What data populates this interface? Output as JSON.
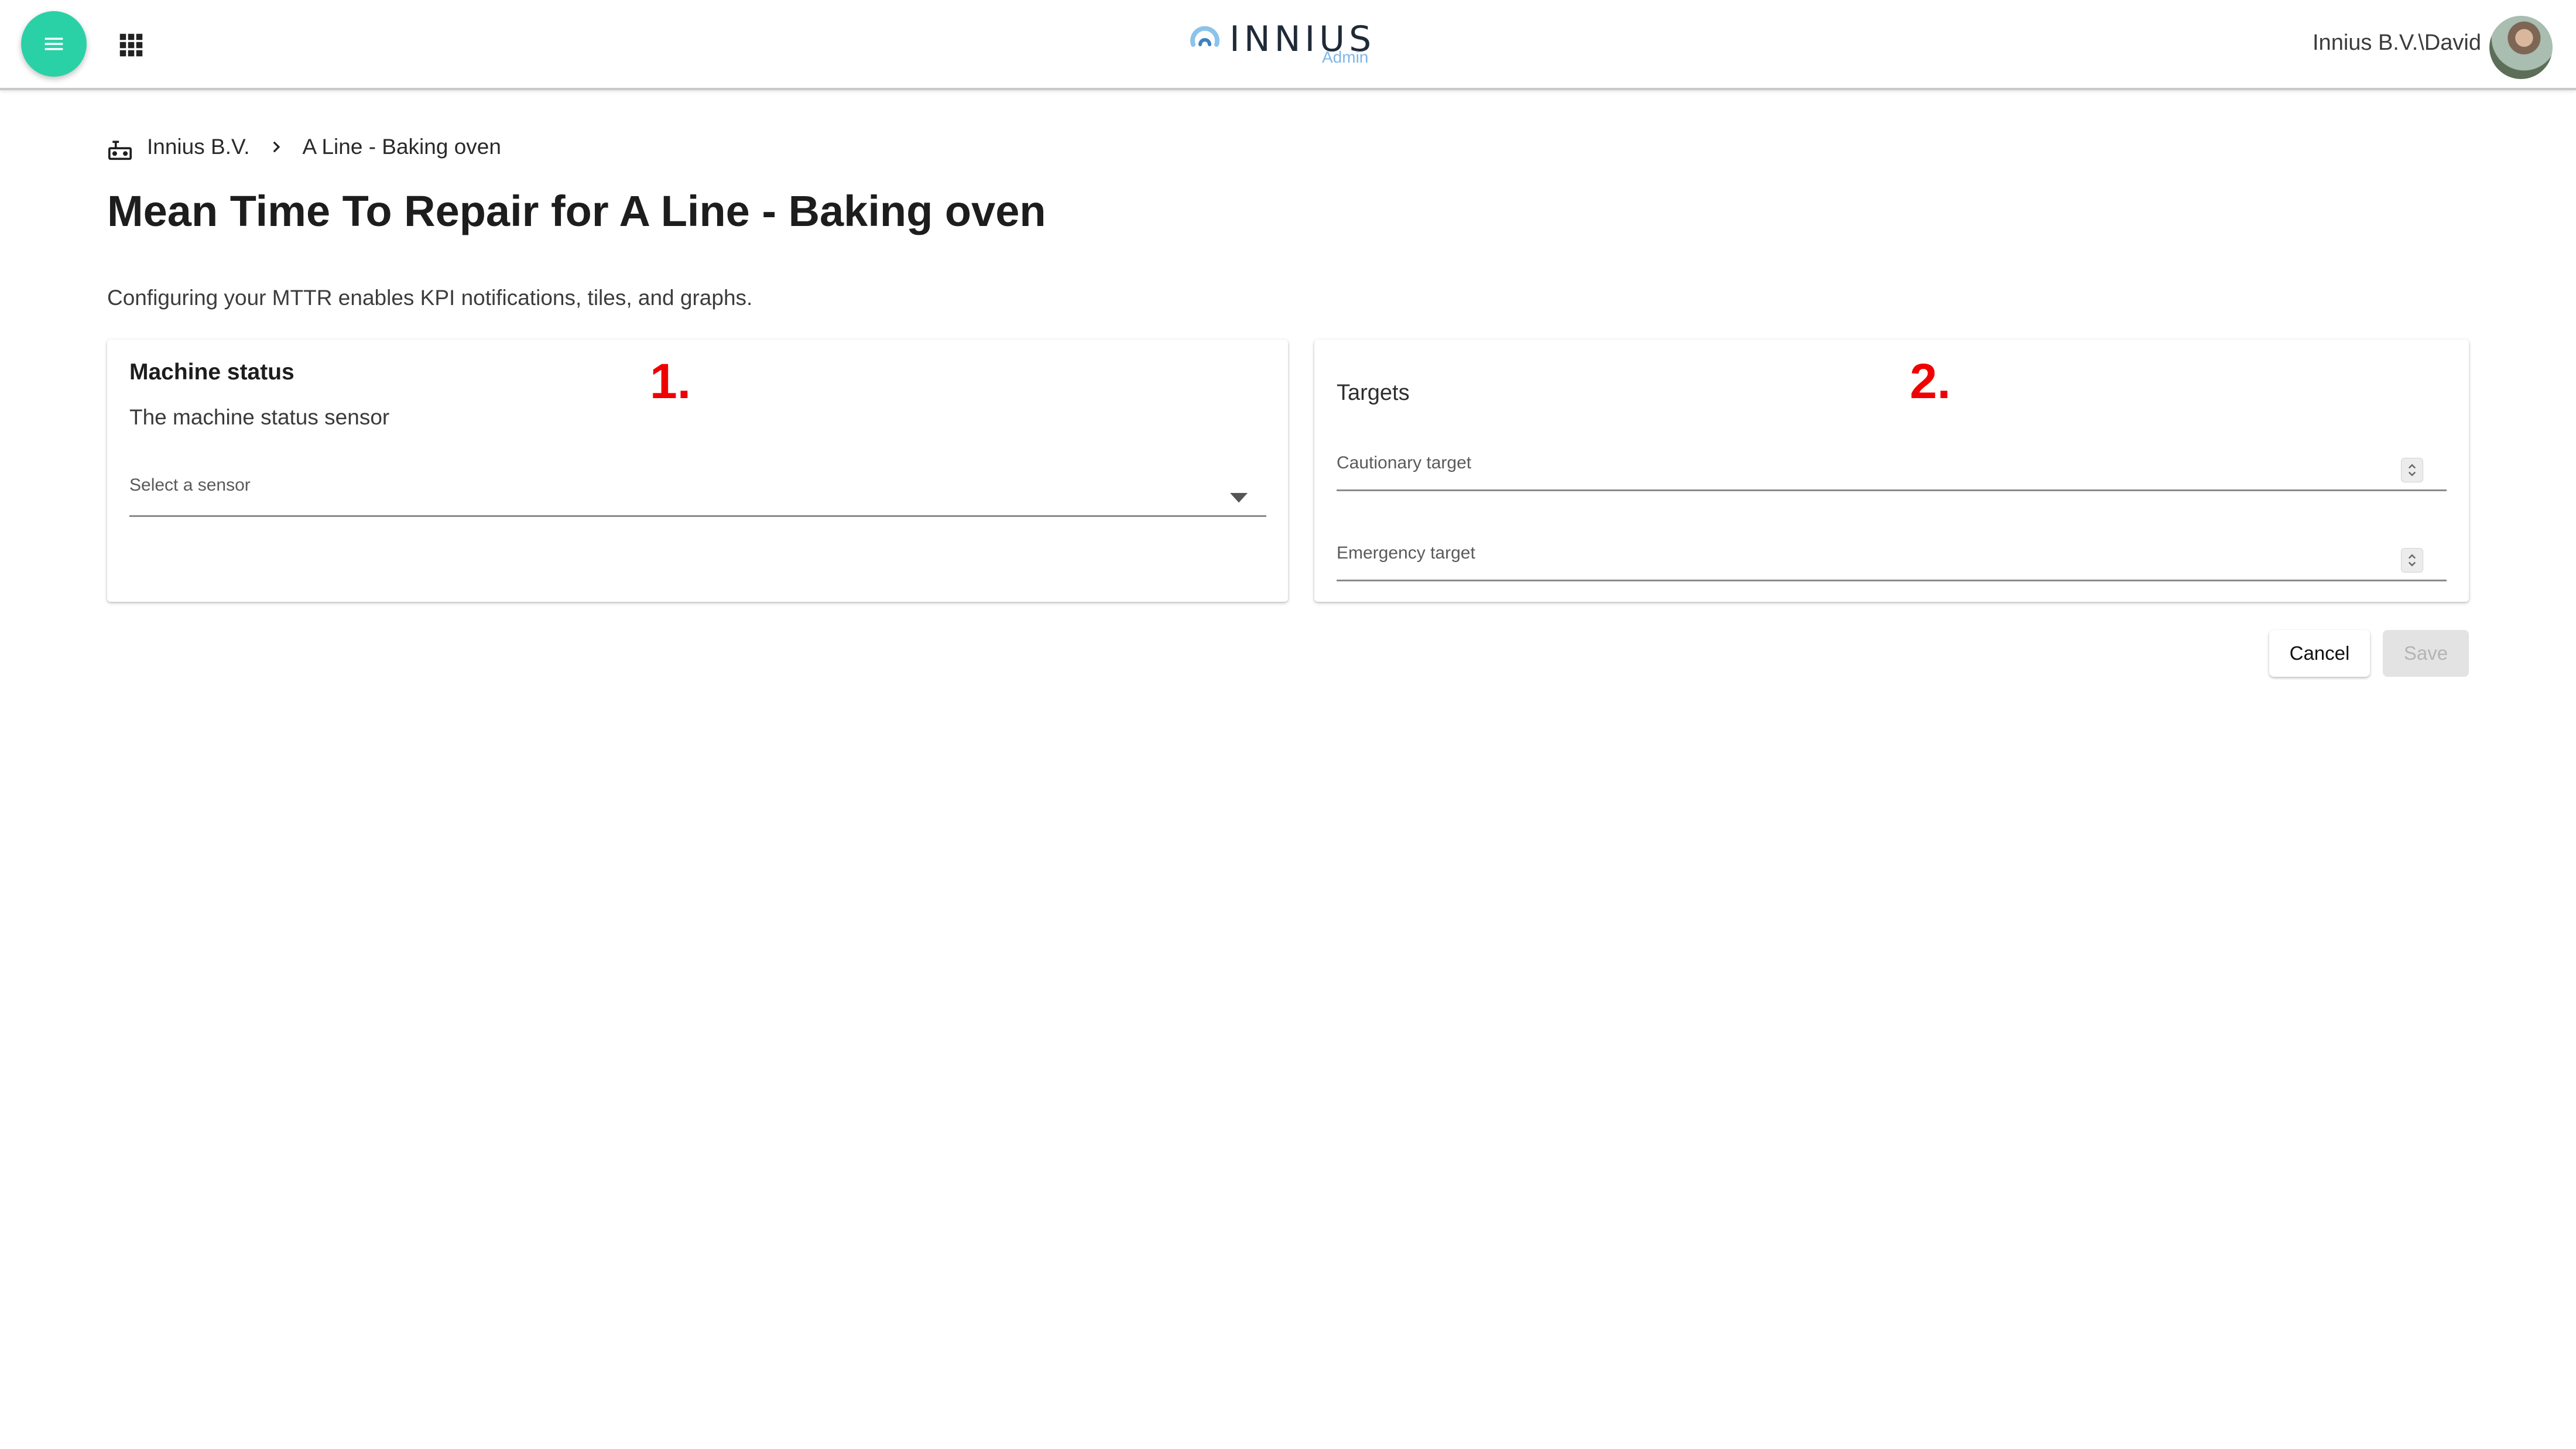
{
  "header": {
    "menu_icon": "hamburger-menu-icon",
    "apps_icon": "apps-grid-icon",
    "logo": {
      "wordmark": "INNIUS",
      "sub": "Admin"
    },
    "user": "Innius B.V.\\David"
  },
  "breadcrumb": {
    "icon": "machine-icon",
    "items": [
      "Innius B.V.",
      "A Line - Baking oven"
    ]
  },
  "page": {
    "title": "Mean Time To Repair for A Line - Baking oven",
    "description": "Configuring your MTTR enables KPI notifications, tiles, and graphs."
  },
  "machine_status": {
    "heading": "Machine status",
    "subtitle": "The machine status sensor",
    "select_label": "Select a sensor",
    "annotation": "1."
  },
  "targets": {
    "heading": "Targets",
    "cautionary_label": "Cautionary target",
    "emergency_label": "Emergency target",
    "annotation": "2."
  },
  "actions": {
    "cancel": "Cancel",
    "save": "Save"
  },
  "colors": {
    "accent": "#2bd1a6",
    "annotation": "#f00000",
    "logo_sub": "#7fb6e6"
  }
}
